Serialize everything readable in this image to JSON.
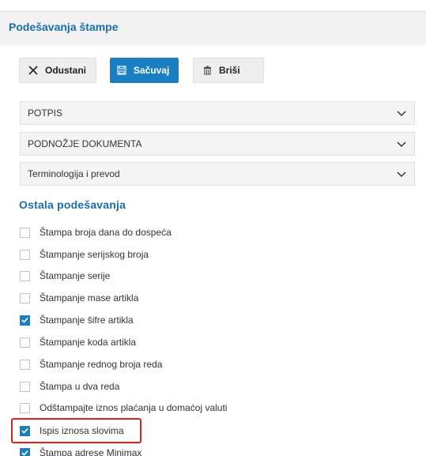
{
  "header": {
    "title": "Podešavanja štampe"
  },
  "toolbar": {
    "cancel_label": "Odustani",
    "save_label": "Sačuvaj",
    "delete_label": "Briši"
  },
  "accordions": [
    {
      "label": "POTPIS"
    },
    {
      "label": "PODNOŽJE DOKUMENTA"
    },
    {
      "label": "Terminologija i prevod"
    }
  ],
  "other_settings": {
    "title": "Ostala podešavanja",
    "items": [
      {
        "label": "Štampa broja dana do dospeća",
        "checked": false
      },
      {
        "label": "Štampanje serijskog broja",
        "checked": false
      },
      {
        "label": "Štampanje serije",
        "checked": false
      },
      {
        "label": "Štampanje mase artikla",
        "checked": false
      },
      {
        "label": "Štampanje šifre artikla",
        "checked": true
      },
      {
        "label": "Štampanje koda artikla",
        "checked": false
      },
      {
        "label": "Štampanje rednog broja reda",
        "checked": false
      },
      {
        "label": "Štampa u dva reda",
        "checked": false
      },
      {
        "label": "Odštampajte iznos plaćanja u domaćoj valuti",
        "checked": false
      },
      {
        "label": "Ispis iznosa slovima",
        "checked": true
      },
      {
        "label": "Štampa adrese Minimax",
        "checked": true
      }
    ]
  },
  "colors": {
    "accent": "#1a7fc1",
    "title": "#1a6fa8",
    "highlight": "#e0201f"
  }
}
